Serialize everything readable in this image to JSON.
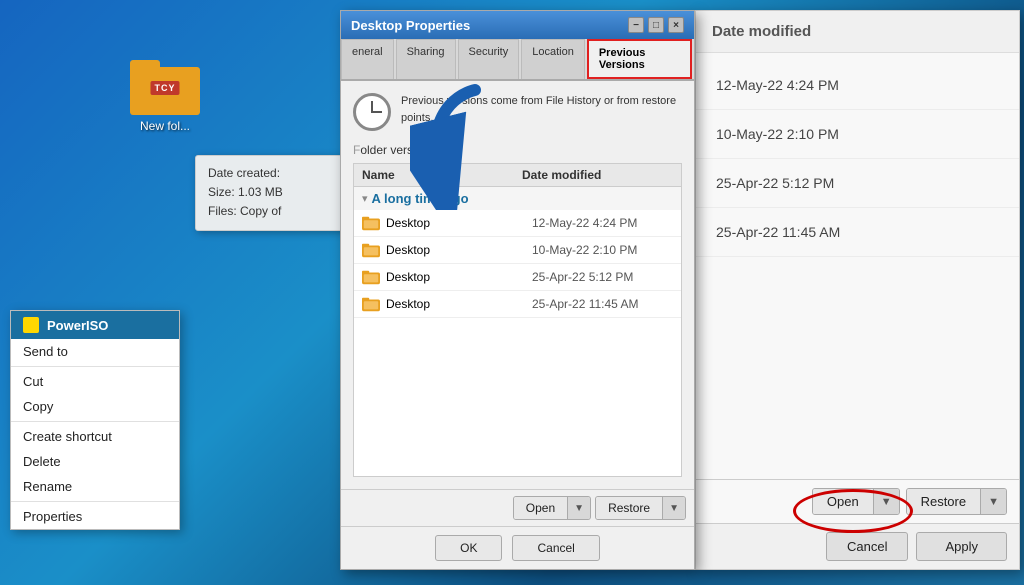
{
  "desktop": {
    "folder_label": "TCY",
    "folder_name": "New fol..."
  },
  "info_bubble": {
    "line1": "Date created:",
    "line2": "Size: 1.03 MB",
    "line3": "Files: Copy of"
  },
  "context_menu": {
    "header": "PowerISO",
    "items": [
      "Send to",
      "Cut",
      "Copy",
      "Create shortcut",
      "Delete",
      "Rename",
      "Properties"
    ]
  },
  "dialog_left": {
    "title": "Desktop Properties",
    "tabs": [
      {
        "label": "eneral",
        "active": false
      },
      {
        "label": "Sharing",
        "active": false
      },
      {
        "label": "Security",
        "active": false
      },
      {
        "label": "Location",
        "active": false
      },
      {
        "label": "Previous Versions",
        "active": true,
        "highlighted": true
      }
    ],
    "pv_info": "Previous versions come from File History or from restore points.",
    "folder_versions_label": "older versions:",
    "table_cols": [
      "Name",
      "Date modified"
    ],
    "section_label": "A long time ago",
    "rows": [
      {
        "name": "Desktop",
        "date": "12-May-22 4:24 PM"
      },
      {
        "name": "Desktop",
        "date": "10-May-22 2:10 PM"
      },
      {
        "name": "Desktop",
        "date": "25-Apr-22 5:12 PM"
      },
      {
        "name": "Desktop",
        "date": "25-Apr-22 11:45 AM"
      }
    ],
    "open_btn": "Open",
    "restore_btn": "Restore",
    "ok_btn": "OK",
    "cancel_btn": "Cancel"
  },
  "right_panel": {
    "header": "Date modified",
    "dates": [
      "12-May-22 4:24 PM",
      "10-May-22 2:10 PM",
      "25-Apr-22 5:12 PM",
      "25-Apr-22 11:45 AM"
    ],
    "open_btn": "Open",
    "restore_btn": "Restore",
    "cancel_btn": "Cancel",
    "apply_btn": "Apply"
  }
}
